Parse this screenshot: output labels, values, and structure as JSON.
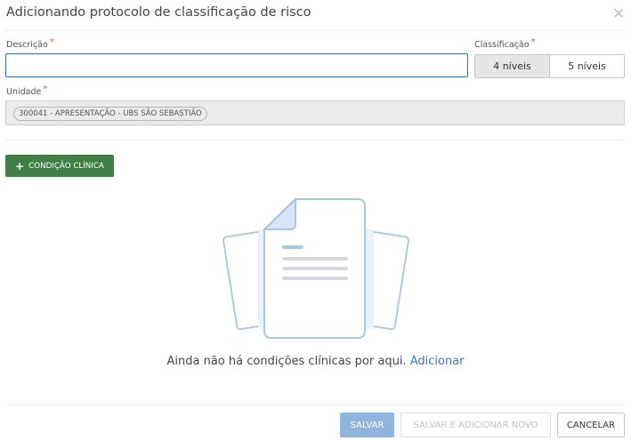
{
  "dialog": {
    "title": "Adicionando protocolo de classificação de risco",
    "close_glyph": "×"
  },
  "form": {
    "descricao": {
      "label": "Descrição",
      "required_mark": "*",
      "value": ""
    },
    "classificacao": {
      "label": "Classificação",
      "required_mark": "*",
      "options": [
        "4 níveis",
        "5 níveis"
      ],
      "selected": "4 níveis"
    },
    "unidade": {
      "label": "Unidade",
      "required_mark": "*",
      "chip": "300041 - APRESENTAÇÃO - UBS SÃO SEBASTIÃO"
    }
  },
  "actions": {
    "add_condition": {
      "icon": "plus-icon",
      "label": "CONDIÇÃO CLÍNICA"
    }
  },
  "empty_state": {
    "icon": "documents-illustration",
    "message": "Ainda não há condições clínicas por aqui.",
    "link": "Adicionar"
  },
  "footer": {
    "save": "SALVAR",
    "save_new": "SALVAR E ADICIONAR NOVO",
    "cancel": "CANCELAR"
  },
  "colors": {
    "primary_green": "#3f7f46",
    "link_blue": "#3a7bc0",
    "save_disabled_blue": "#8fb4dd",
    "required_red": "#d9534f",
    "focus_border": "#3a6db5"
  }
}
